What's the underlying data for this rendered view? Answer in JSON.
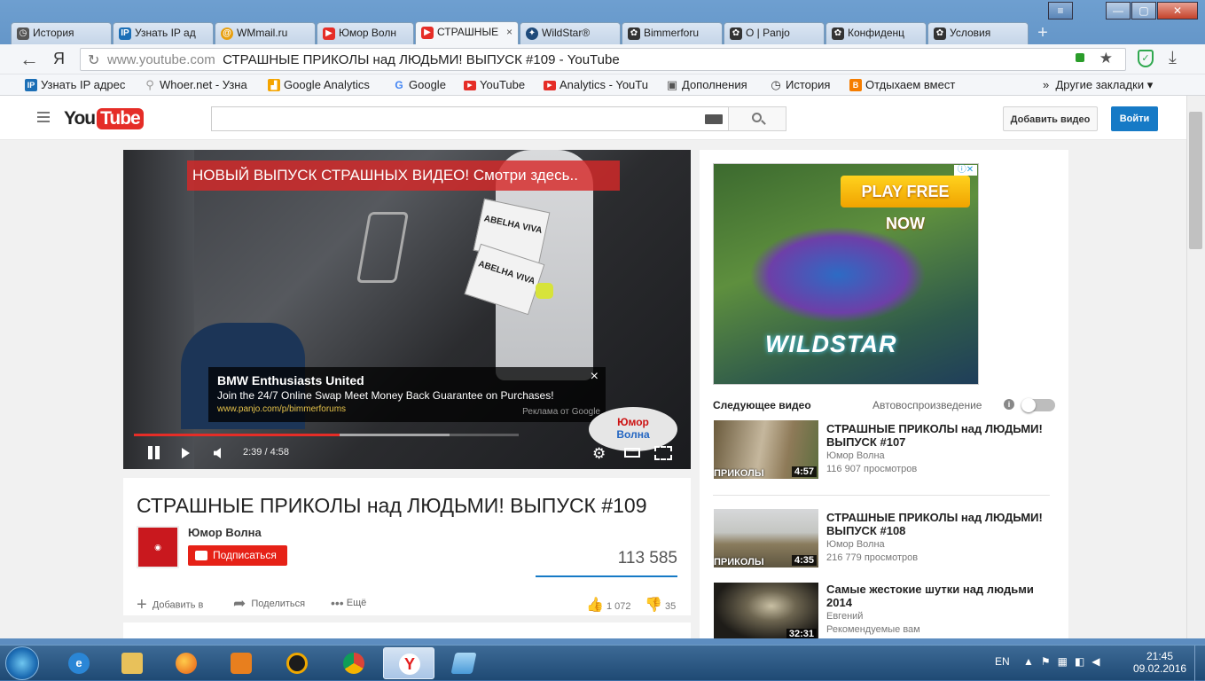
{
  "browser": {
    "tabs": [
      {
        "label": "История",
        "icon": "history-icon",
        "color": "#555"
      },
      {
        "label": "Узнать IP ад",
        "icon": "ip-icon",
        "color": "#1c6fb6"
      },
      {
        "label": "WMmail.ru",
        "icon": "wmmail-icon",
        "color": "#e8a010"
      },
      {
        "label": "Юмор Волн",
        "icon": "youtube-icon",
        "color": "#e52d27"
      },
      {
        "label": "СТРАШНЫЕ",
        "icon": "youtube-icon",
        "color": "#e52d27"
      },
      {
        "label": "WildStar®",
        "icon": "wildstar-icon",
        "color": "#1e4a7a"
      },
      {
        "label": "Bimmerforu",
        "icon": "panjo-icon",
        "color": "#333"
      },
      {
        "label": "O | Panjo",
        "icon": "panjo-icon",
        "color": "#333"
      },
      {
        "label": "Конфиденц",
        "icon": "panjo-icon",
        "color": "#333"
      },
      {
        "label": "Условия",
        "icon": "panjo-icon",
        "color": "#333"
      }
    ],
    "tab_close": "×",
    "new_tab": "+",
    "win_controls": {
      "menu": "≡",
      "min": "—",
      "max": "▢",
      "close": "✕"
    },
    "back": "←",
    "yandex": "Я",
    "address_host": "www.youtube.com",
    "address_title": "СТРАШНЫЕ ПРИКОЛЫ над ЛЮДЬМИ! ВЫПУСК #109 - YouTube",
    "bookmarks": [
      {
        "label": "Узнать IP адрес",
        "icon": "ip-icon",
        "color": "#1c6fb6",
        "glyph": "IP"
      },
      {
        "label": "Whoer.net - Узна",
        "icon": "search-icon",
        "color": "#999",
        "glyph": "⚲"
      },
      {
        "label": "Google Analytics",
        "icon": "analytics-icon",
        "color": "#f4a400",
        "glyph": "▟"
      },
      {
        "label": "Google",
        "icon": "google-icon",
        "color": "#4285f4",
        "glyph": "G"
      },
      {
        "label": "YouTube",
        "icon": "youtube-icon",
        "color": "#e52d27",
        "glyph": "▶"
      },
      {
        "label": "Analytics - YouTu",
        "icon": "youtube-icon",
        "color": "#e52d27",
        "glyph": "▶"
      },
      {
        "label": "Дополнения",
        "icon": "extensions-icon",
        "color": "#555",
        "glyph": "▣"
      },
      {
        "label": "История",
        "icon": "history-icon",
        "color": "#333",
        "glyph": "◷"
      },
      {
        "label": "Отдыхаем вмест",
        "icon": "blogger-icon",
        "color": "#f57d00",
        "glyph": "B"
      }
    ],
    "other_bookmarks": "Другие закладки"
  },
  "youtube": {
    "upload_btn": "Добавить видео",
    "signin_btn": "Войти",
    "ad_banner": "НОВЫЙ ВЫПУСК СТРАШНЫХ ВИДЕО! Смотри здесь..",
    "overlay_ad": {
      "title": "BMW Enthusiasts United",
      "text": "Join the 24/7 Online Swap Meet Money Back Guarantee on Purchases!",
      "url": "www.panjo.com/p/bimmerforums",
      "by": "Реклама от Google",
      "close": "×"
    },
    "player": {
      "time": "2:39 / 4:58",
      "progress": 0.534,
      "buffered": 0.82,
      "watermark_top": "Юмор",
      "watermark_bottom": "Волна",
      "sign1": "ABELHA VIVA",
      "sign2": "ABELHA VIVA"
    },
    "video_title": "СТРАШНЫЕ ПРИКОЛЫ над ЛЮДЬМИ! ВЫПУСК #109",
    "channel": "Юмор Волна",
    "subscribe": "Подписаться",
    "views": "113 585",
    "actions": {
      "add": "Добавить в",
      "share": "Поделиться",
      "more": "Ещё"
    },
    "likes": "1 072",
    "dislikes": "35",
    "side_ad": {
      "cta": "PLAY FREE NOW",
      "brand": "WILDSTAR"
    },
    "up_next": "Следующее видео",
    "autoplay": "Автовоспроизведение",
    "related": [
      {
        "title": "СТРАШНЫЕ ПРИКОЛЫ над ЛЮДЬМИ! ВЫПУСК #107",
        "channel": "Юмор Волна",
        "views": "116 907 просмотров",
        "duration": "4:57",
        "thumb_text": "ПРИКОЛЫ"
      },
      {
        "title": "СТРАШНЫЕ ПРИКОЛЫ над ЛЮДЬМИ! ВЫПУСК #108",
        "channel": "Юмор Волна",
        "views": "216 779 просмотров",
        "duration": "4:35",
        "thumb_text": "ПРИКОЛЫ"
      },
      {
        "title": "Самые жестокие шутки над людьми 2014",
        "channel": "Евгений",
        "views": "Рекомендуемые вам",
        "duration": "32:31",
        "thumb_text": ""
      }
    ]
  },
  "taskbar": {
    "lang": "EN",
    "time": "21:45",
    "date": "09.02.2016"
  }
}
